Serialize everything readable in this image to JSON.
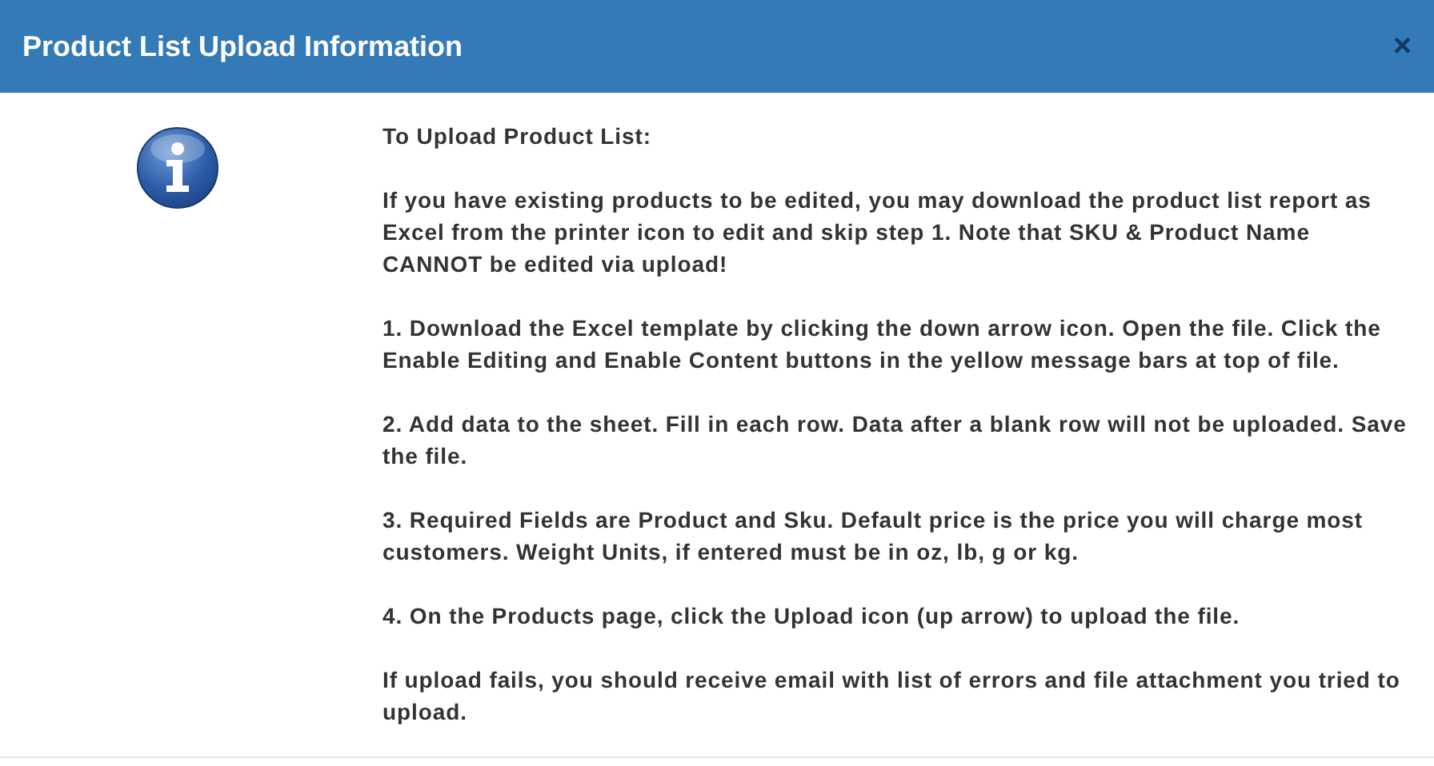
{
  "dialog": {
    "title": "Product List Upload Information",
    "close": "×",
    "heading": "To Upload Product List:",
    "paragraphs": [
      "If you have existing products to be edited, you may download the product list report as Excel from the printer icon to edit and skip step 1. Note that SKU & Product Name CANNOT be edited via upload!",
      "1. Download the Excel template by clicking the down arrow icon. Open the file. Click the Enable Editing and Enable Content buttons in the yellow message bars at top of file.",
      "2. Add data to the sheet. Fill in each row. Data after a blank row will not be uploaded. Save the file.",
      "3. Required Fields are Product and Sku. Default price is the price you will charge most customers. Weight Units, if entered must be in oz, lb, g or kg.",
      "4. On the Products page, click the Upload icon (up arrow) to upload the file.",
      "If upload fails, you should receive email with list of errors and file attachment you tried to upload."
    ]
  }
}
